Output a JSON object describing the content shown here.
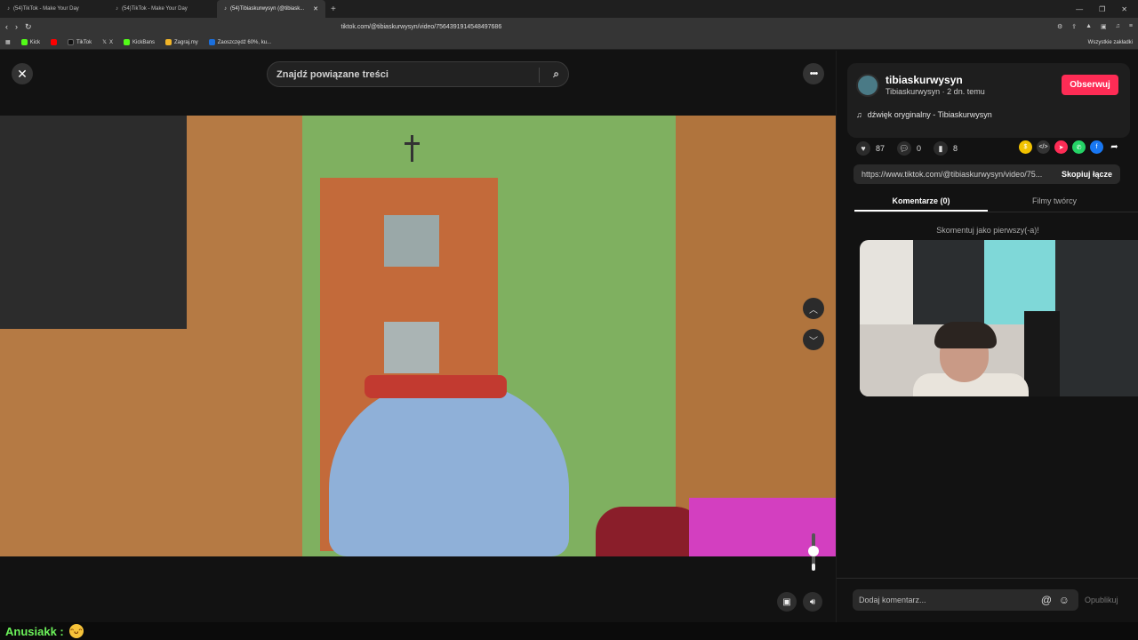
{
  "browser": {
    "tabs": [
      {
        "label": "(54)TikTok - Make Your Day",
        "active": false
      },
      {
        "label": "(54)TikTok - Make Your Day",
        "active": false
      },
      {
        "label": "(54)Tibiaskurwysyn (@tibiask...",
        "active": true
      }
    ],
    "url": "tiktok.com/@tibiaskurwysyn/video/7564391914548497686",
    "bookmarks": [
      {
        "label": "Kick",
        "color": "#53fc18"
      },
      {
        "label": "",
        "color": "#ff0000"
      },
      {
        "label": "TikTok",
        "color": "#111111"
      },
      {
        "label": "X",
        "color": "#111111"
      },
      {
        "label": "KickBans",
        "color": "#53fc18"
      },
      {
        "label": "Zagraj.my",
        "color": "#f0b428"
      },
      {
        "label": "Zaoszczędź 60%, ku...",
        "color": "#1b6fdc"
      }
    ],
    "all_bookmarks": "Wszystkie zakładki"
  },
  "player": {
    "search_placeholder": "Znajdź powiązane treści",
    "volume_level": 0.7
  },
  "sidebar": {
    "username": "tibiaskurwysyn",
    "subline": "Tibiaskurwysyn · 2 dn. temu",
    "follow_label": "Obserwuj",
    "sound": "dźwięk oryginalny - Tibiaskurwysyn",
    "likes": "87",
    "comments": "0",
    "saves": "8",
    "link_text": "https://www.tiktok.com/@tibiaskurwysyn/video/75...",
    "copy_label": "Skopiuj łącze",
    "tab_comments": "Komentarze (0)",
    "tab_creator": "Filmy twórcy",
    "first_comment": "Skomentuj jako pierwszy(-a)!",
    "comment_placeholder": "Dodaj komentarz...",
    "publish_label": "Opublikuj",
    "accent": "#fe2c55"
  },
  "chat": {
    "name": "Anusiakk :",
    "emote": "grinning-face-emote"
  }
}
